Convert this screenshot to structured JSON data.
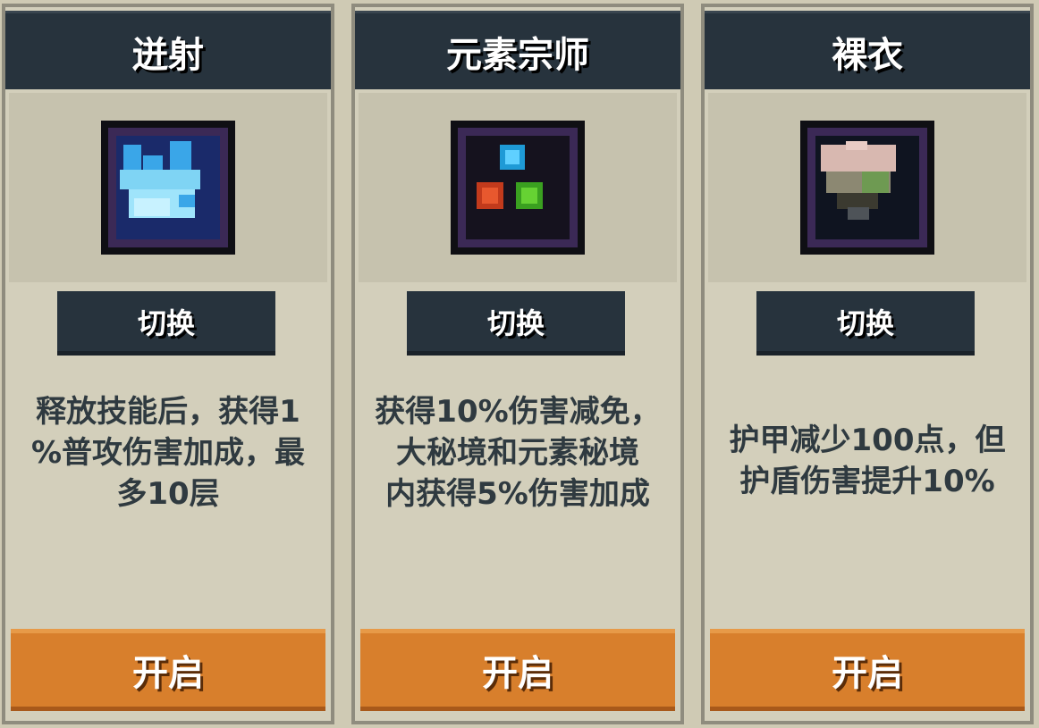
{
  "cards": [
    {
      "title": "迸射",
      "icon": "ice-burst-icon",
      "switch_label": "切换",
      "description": "释放技能后，获得1\n%普攻伤害加成，最\n多10层",
      "open_label": "开启"
    },
    {
      "title": "元素宗师",
      "icon": "element-orbs-icon",
      "switch_label": "切换",
      "description": "获得10%伤害减免，\n大秘境和元素秘境\n内获得5%伤害加成",
      "open_label": "开启"
    },
    {
      "title": "裸衣",
      "icon": "bare-torso-icon",
      "switch_label": "切换",
      "description": "护甲减少100点，但\n护盾伤害提升10%",
      "open_label": "开启"
    }
  ],
  "colors": {
    "header_bg": "#27333d",
    "button_orange": "#d87f2c",
    "panel_bg": "#d3cfbb",
    "icon_border": "#3b2956"
  }
}
